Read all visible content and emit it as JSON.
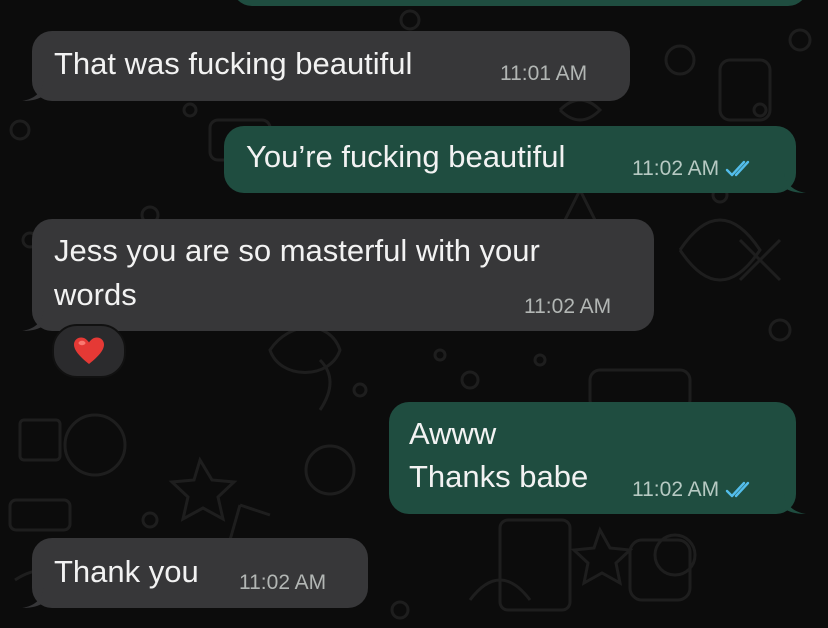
{
  "messages": [
    {
      "id": "m0",
      "direction": "outgoing",
      "text": "",
      "time": ""
    },
    {
      "id": "m1",
      "direction": "incoming",
      "text": "That was fucking beautiful",
      "time": "11:01 AM"
    },
    {
      "id": "m2",
      "direction": "outgoing",
      "text": "You’re fucking beautiful",
      "time": "11:02 AM",
      "status": "read"
    },
    {
      "id": "m3",
      "direction": "incoming",
      "lines": [
        "Jess you are so masterful with your",
        "words"
      ],
      "time": "11:02 AM",
      "reaction": "heart-emoji"
    },
    {
      "id": "m4",
      "direction": "outgoing",
      "lines": [
        "Awww",
        "Thanks babe"
      ],
      "time": "11:02 AM",
      "status": "read"
    },
    {
      "id": "m5",
      "direction": "incoming",
      "text": "Thank you",
      "time": "11:02 AM"
    }
  ],
  "colors": {
    "background": "#0c0c0c",
    "incoming_bubble": "#373739",
    "outgoing_bubble": "#1f4d40",
    "read_ticks": "#53bdeb",
    "reaction_heart": "#e53935"
  }
}
